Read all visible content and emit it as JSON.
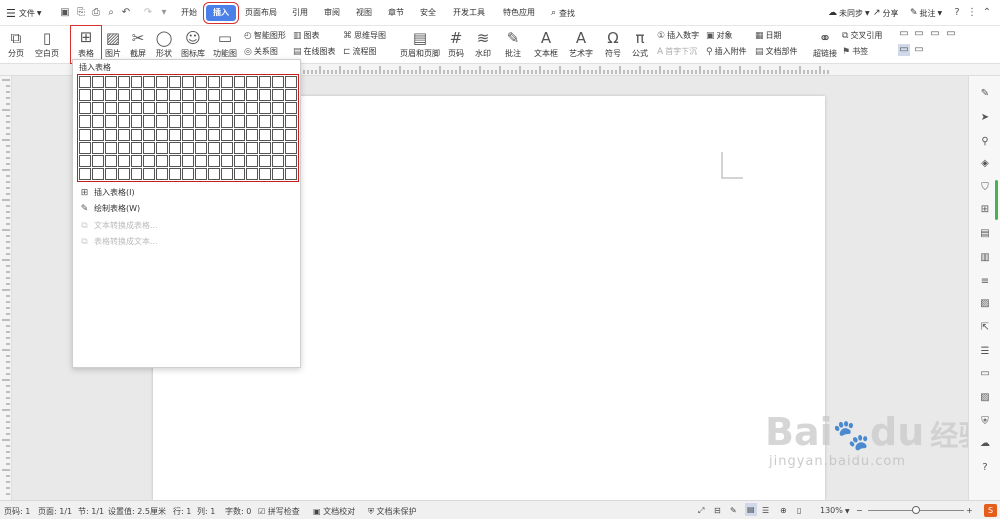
{
  "titlebar": {
    "menu_label": "文件",
    "tabs": [
      "开始",
      "插入",
      "页面布局",
      "引用",
      "审阅",
      "视图",
      "章节",
      "安全",
      "开发工具",
      "特色应用"
    ],
    "active_tab": "插入",
    "search_label": "查找",
    "sync_label": "未同步",
    "share_label": "分享",
    "comment_label": "批注"
  },
  "ribbon": {
    "page_break": "分页",
    "blank_page": "空白页",
    "table": "表格",
    "picture": "图片",
    "screenshot": "截屏",
    "shapes": "形状",
    "icon_lib": "图标库",
    "func_chart": "功能图",
    "smart_shape": "智能图形",
    "chart": "图表",
    "mindmap": "思维导图",
    "relation_chart": "关系图",
    "online_chart": "在线图表",
    "flowchart": "流程图",
    "header_footer": "页眉和页脚",
    "page_number": "页码",
    "watermark": "水印",
    "comment": "批注",
    "textbox": "文本框",
    "wordart": "艺术字",
    "symbol": "符号",
    "formula": "公式",
    "insert_number": "插入数字",
    "object": "对象",
    "date": "日期",
    "first_drop": "首字下沉",
    "attach": "插入附件",
    "doc_parts": "文档部件",
    "hyperlink": "超链接",
    "cross_ref": "交叉引用",
    "bookmark": "书签"
  },
  "dropdown": {
    "title": "插入表格",
    "grid_rows": 8,
    "grid_cols": 17,
    "items": [
      {
        "label": "插入表格(I)",
        "enabled": true
      },
      {
        "label": "绘制表格(W)",
        "enabled": true
      },
      {
        "label": "文本转换成表格...",
        "enabled": false
      },
      {
        "label": "表格转换成文本...",
        "enabled": false
      }
    ]
  },
  "statusbar": {
    "page_code": "页码: 1",
    "page": "页面: 1/1",
    "section": "节: 1/1",
    "setting": "设置值: 2.5厘米",
    "row": "行: 1",
    "col": "列: 1",
    "words": "字数: 0",
    "spell": "拼写检查",
    "proof": "文档校对",
    "protect": "文档未保护",
    "zoom": "130%",
    "zoom_level": 0.5
  },
  "watermark": {
    "brand": "Bai",
    "brand2": "du",
    "cn": "经验",
    "url": "jingyan.baidu.com"
  }
}
